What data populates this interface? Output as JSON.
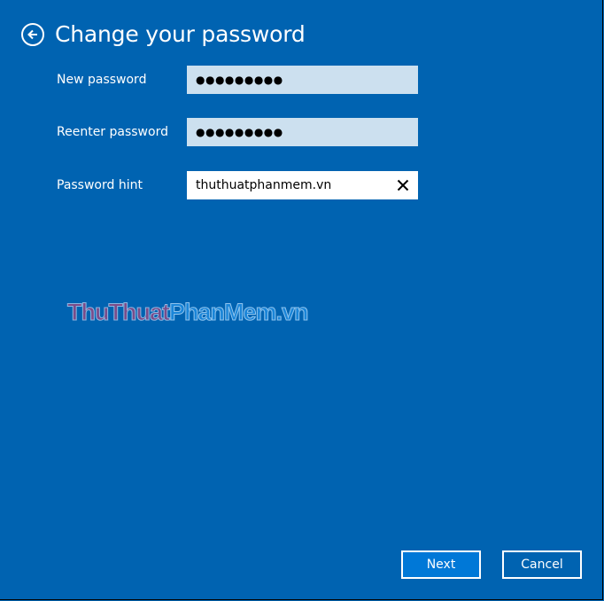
{
  "header": {
    "title": "Change your password",
    "back_icon": "back-arrow-circle-icon"
  },
  "form": {
    "new_password": {
      "label": "New password",
      "value": "●●●●●●●●●"
    },
    "reenter_password": {
      "label": "Reenter password",
      "value": "●●●●●●●●●"
    },
    "password_hint": {
      "label": "Password hint",
      "value": "thuthuatphanmem.vn",
      "clear_icon": "close-icon"
    }
  },
  "watermark": {
    "part1": "ThuThuat",
    "part2": "PhanMem.vn"
  },
  "buttons": {
    "next": "Next",
    "cancel": "Cancel"
  },
  "colors": {
    "background": "#0063b1",
    "accent": "#0078d7",
    "password_field": "#cce0ef"
  }
}
